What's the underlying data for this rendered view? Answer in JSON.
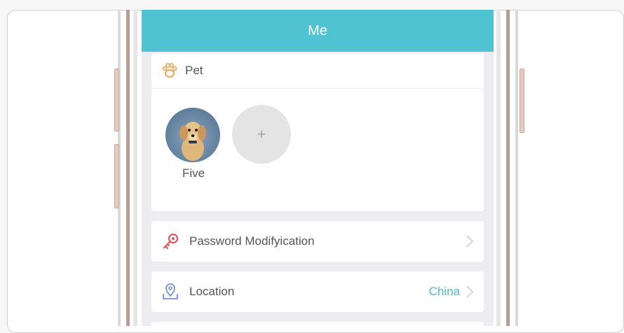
{
  "header": {
    "title": "Me"
  },
  "pet_section": {
    "label": "Pet",
    "pets": [
      {
        "name": "Five"
      }
    ],
    "add_symbol": "+"
  },
  "menu": {
    "password": {
      "label": "Password Modifyication"
    },
    "location": {
      "label": "Location",
      "value": "China"
    }
  },
  "colors": {
    "accent": "#4fc3d2",
    "value_text": "#4fb9c9",
    "paw_icon": "#f2a65a",
    "key_icon": "#e0575a",
    "location_icon": "#7a8fd6"
  },
  "icons": {
    "pet": "paw-icon",
    "password": "key-icon",
    "location": "location-pin-icon",
    "chevron": "chevron-right-icon",
    "add": "plus-icon"
  }
}
